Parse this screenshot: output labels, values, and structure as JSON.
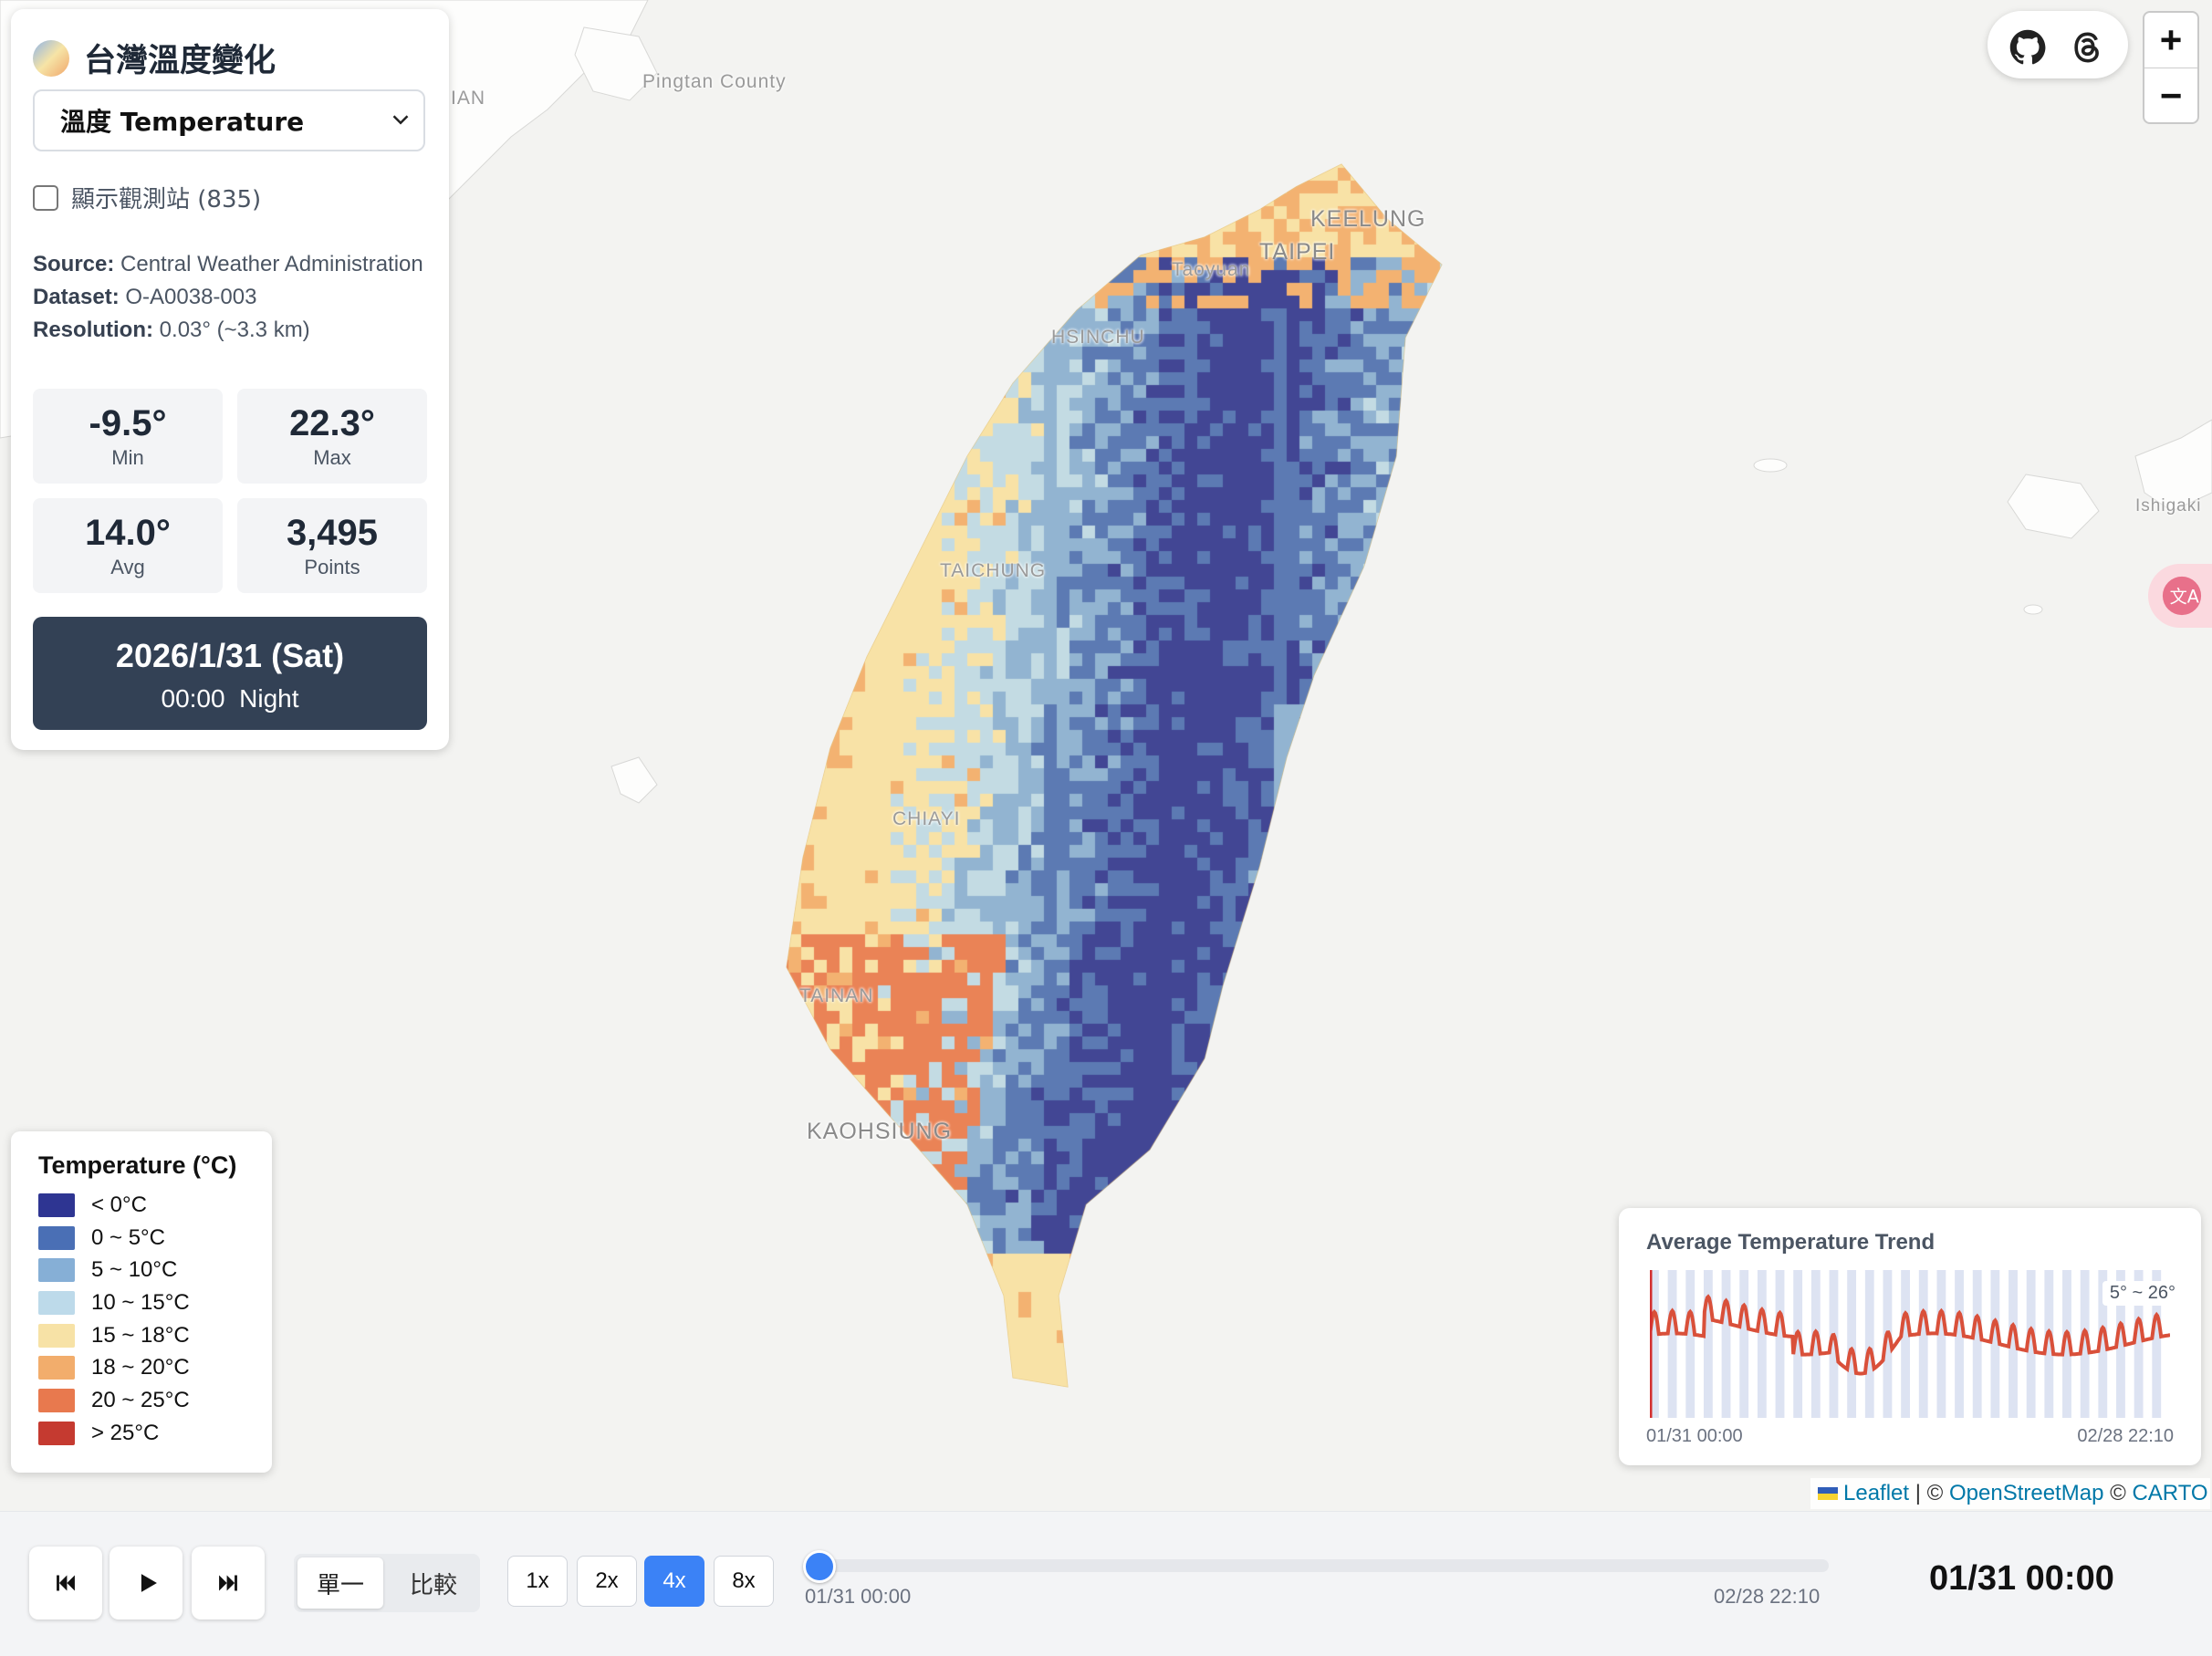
{
  "app": {
    "title": "台灣溫度變化",
    "variable_select": "溫度 Temperature",
    "stations_label": "顯示觀測站 (835)"
  },
  "meta": {
    "source_label": "Source:",
    "source_value": "Central Weather Administration",
    "dataset_label": "Dataset:",
    "dataset_value": "O-A0038-003",
    "resolution_label": "Resolution:",
    "resolution_value": "0.03° (~3.3 km)"
  },
  "stats": {
    "min_value": "-9.5°",
    "min_label": "Min",
    "max_value": "22.3°",
    "max_label": "Max",
    "avg_value": "14.0°",
    "avg_label": "Avg",
    "points_value": "3,495",
    "points_label": "Points"
  },
  "datetime": {
    "date": "2026/1/31 (Sat)",
    "time": "00:00  Night"
  },
  "map_labels": [
    "Pingtan County",
    "KEELUNG",
    "TAIPEI",
    "Taoyuan",
    "HSINCHU",
    "TAICHUNG",
    "CHIAYI",
    "TAINAN",
    "KAOHSIUNG",
    "Ishigaki",
    "IAN"
  ],
  "legend": {
    "title": "Temperature (°C)",
    "items": [
      {
        "label": "< 0°C",
        "color": "#2e3592"
      },
      {
        "label": "0 ~ 5°C",
        "color": "#4a6fb5"
      },
      {
        "label": "5 ~ 10°C",
        "color": "#86afd6"
      },
      {
        "label": "10 ~ 15°C",
        "color": "#bddaea"
      },
      {
        "label": "15 ~ 18°C",
        "color": "#f7e2a6"
      },
      {
        "label": "18 ~ 20°C",
        "color": "#f2ad6c"
      },
      {
        "label": "20 ~ 25°C",
        "color": "#e8794e"
      },
      {
        "label": "> 25°C",
        "color": "#c53a30"
      }
    ]
  },
  "trend": {
    "title": "Average Temperature Trend",
    "range_label": "5° ~ 26°",
    "start_label": "01/31 00:00",
    "end_label": "02/28 22:10"
  },
  "attribution": {
    "leaflet": "Leaflet",
    "sep1": " | © ",
    "osm": "OpenStreetMap",
    "sep2": " © ",
    "carto": "CARTO"
  },
  "zoom": {
    "in": "+",
    "out": "−"
  },
  "controls": {
    "mode_single": "單一",
    "mode_compare": "比較",
    "speeds": [
      "1x",
      "2x",
      "4x",
      "8x"
    ],
    "active_speed": "4x",
    "timeline_start": "01/31 00:00",
    "timeline_end": "02/28 22:10",
    "timeline_progress": 0,
    "current_time": "01/31 00:00"
  },
  "colors": {
    "accent": "#3b82f6",
    "date_bg": "#334155",
    "trend_line": "#d9503a"
  },
  "icons": [
    "github-icon",
    "threads-icon",
    "translate-icon",
    "skip-back-icon",
    "play-icon",
    "skip-forward-icon",
    "chevron-down-icon"
  ]
}
